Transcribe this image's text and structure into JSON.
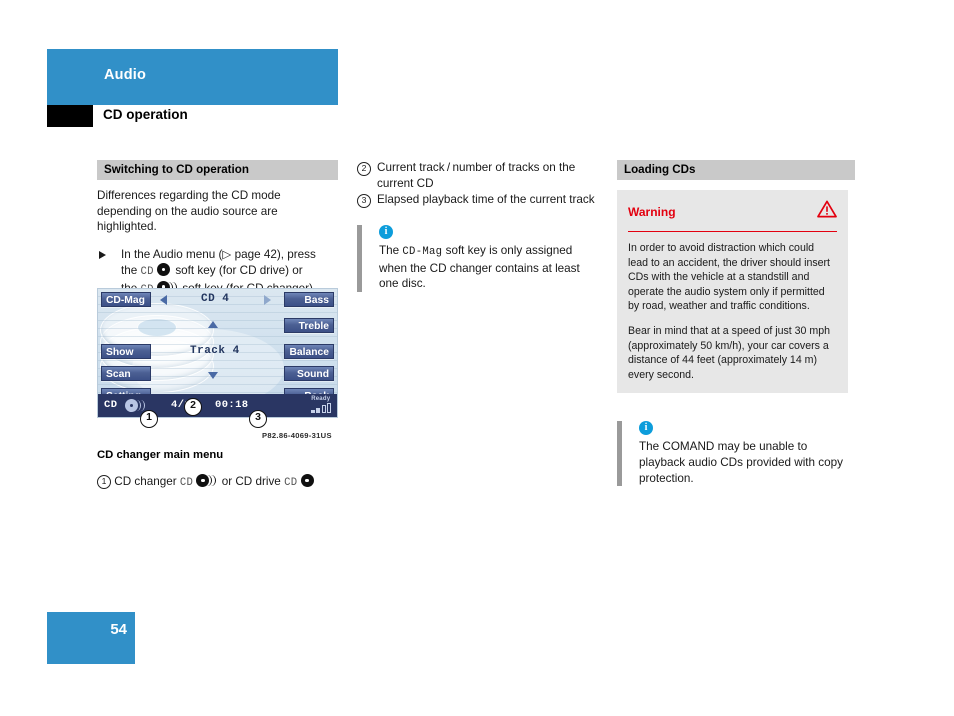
{
  "header": {
    "section": "Audio",
    "title": "CD operation"
  },
  "col1": {
    "section_bar": "Switching to CD operation",
    "intro": "Differences regarding the CD mode depending on the audio source are highlighted.",
    "step": {
      "part1": "In the Audio menu (",
      "ref": "▷ page 42",
      "part2": "), press",
      "line2_pre": "the",
      "line2_cd": "CD",
      "line2_post": "soft key (for CD drive) or",
      "line3_pre": "the",
      "line3_cd": "CD",
      "line3_post": "soft key (for CD changer)."
    },
    "figure_title": "CD changer main menu",
    "figure_code": "P82.86-4069-31US",
    "legend": {
      "num": "1",
      "text_a": "CD changer",
      "cd_a": "CD",
      "text_b": "or CD drive",
      "cd_b": "CD"
    }
  },
  "display": {
    "soft_keys_left": [
      "CD-Mag",
      "Show",
      "Scan",
      "Setting"
    ],
    "soft_keys_right": [
      "Bass",
      "Treble",
      "Balance",
      "Sound",
      "Back"
    ],
    "cd_label": "CD 4",
    "track_label": "Track 4",
    "status_source": "CD",
    "status_track": "4/15",
    "status_time": "00:18",
    "ready_label": "Ready",
    "callouts": [
      "1",
      "2",
      "3"
    ]
  },
  "col2": {
    "items": [
      {
        "num": "2",
        "text": "Current track / number of tracks on the current CD"
      },
      {
        "num": "3",
        "text": "Elapsed playback time of the current track"
      }
    ],
    "note": {
      "icon": "info-icon",
      "pre": "The",
      "mono": "CD-Mag",
      "post": "soft key is only assigned when the CD changer contains at least one disc."
    }
  },
  "col3": {
    "section_bar": "Loading CDs",
    "warning": {
      "title": "Warning",
      "icon": "warning-triangle-icon",
      "paragraphs": [
        "In order to avoid distraction which could lead to an accident, the driver should insert CDs with the vehicle at a standstill and operate the audio system only if permitted by road, weather and traffic conditions.",
        "Bear in mind that at a speed of just 30 mph (approximately 50 km/h), your car covers a distance of 44 feet (approximately 14 m) every second."
      ]
    },
    "note": {
      "icon": "info-icon",
      "text": "The COMAND may be unable to playback audio CDs provided with copy protection."
    }
  },
  "footer": {
    "page_number": "54"
  },
  "colors": {
    "brand_blue": "#3190c8",
    "warning_red": "#e3000f",
    "info_blue": "#0d9ddb",
    "section_bar_gray": "#c9c9c9",
    "warning_bg": "#e7e7e7",
    "soft_key_blue": "#4b5f93",
    "status_bar_navy": "#2a3663"
  }
}
